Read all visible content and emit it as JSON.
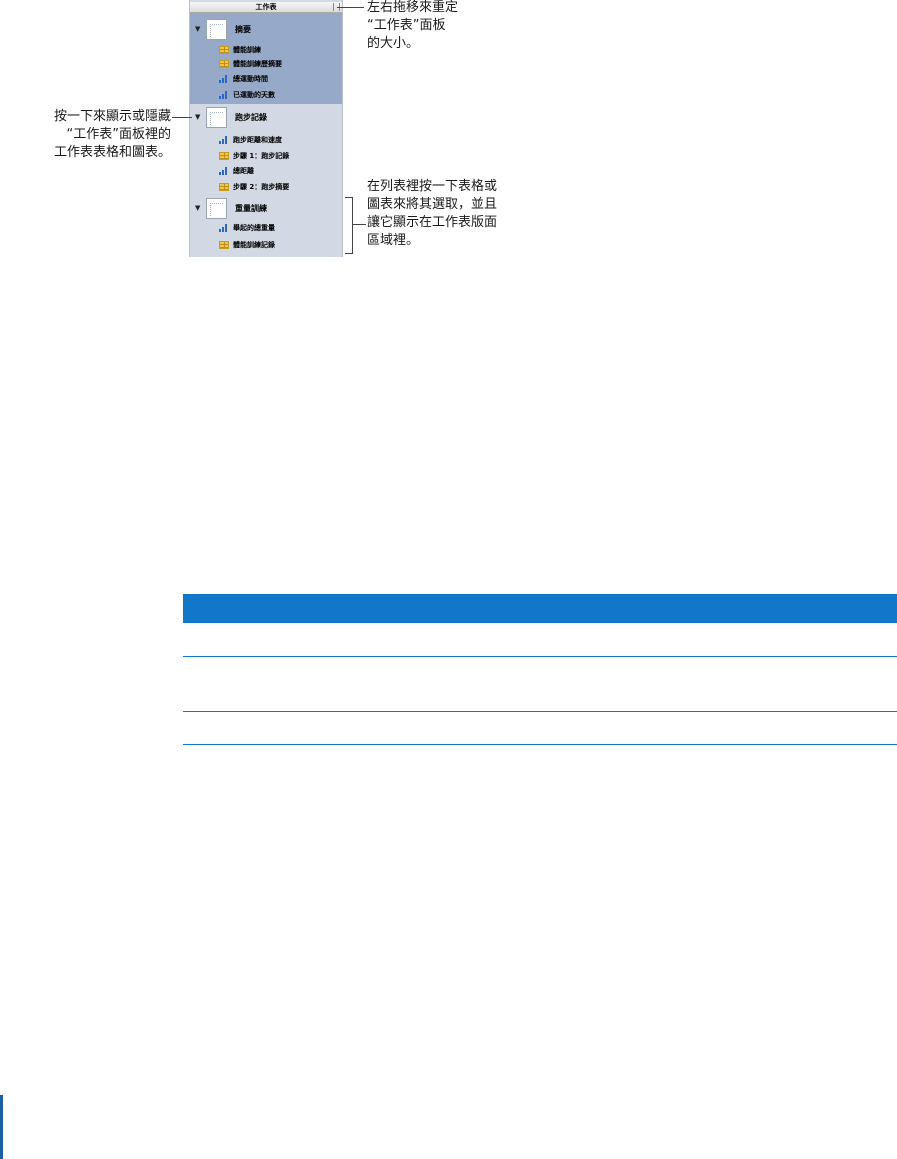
{
  "pane": {
    "header": "工作表",
    "sheets": [
      {
        "label": "摘要",
        "items": [
          {
            "type": "table-icon",
            "label": "體能訓練"
          },
          {
            "type": "table-icon",
            "label": "體能訓練歷摘要"
          },
          {
            "type": "chart-icon",
            "label": "總運動時間"
          },
          {
            "type": "chart-icon",
            "label": "已運動的天數"
          }
        ]
      },
      {
        "label": "跑步記錄",
        "items": [
          {
            "type": "chart-icon",
            "label": "跑步距離和速度"
          },
          {
            "type": "table-icon",
            "label": "步驟 1：跑步記錄"
          },
          {
            "type": "chart-icon",
            "label": "總距離"
          },
          {
            "type": "table-icon",
            "label": "步驟 2：跑步摘要"
          }
        ]
      },
      {
        "label": "重量訓練",
        "items": [
          {
            "type": "chart-icon",
            "label": "舉起的總重量"
          },
          {
            "type": "table-icon",
            "label": "體能訓練記錄"
          }
        ]
      }
    ]
  },
  "callouts": {
    "resize": [
      "左右拖移來重定",
      "“工作表”面板",
      "的大小。"
    ],
    "toggle": [
      "按一下來顯示或隱藏",
      "“工作表”面板裡的",
      "工作表表格和圖表。"
    ],
    "select": [
      "在列表裡按一下表格或",
      "圖表來將其選取，並且",
      "讓它顯示在工作表版面",
      "區域裡。"
    ]
  },
  "colors": {
    "table_header": "#1277c8",
    "pane_selected": "#97a9c9",
    "pane_bg": "#d2d9e4"
  }
}
